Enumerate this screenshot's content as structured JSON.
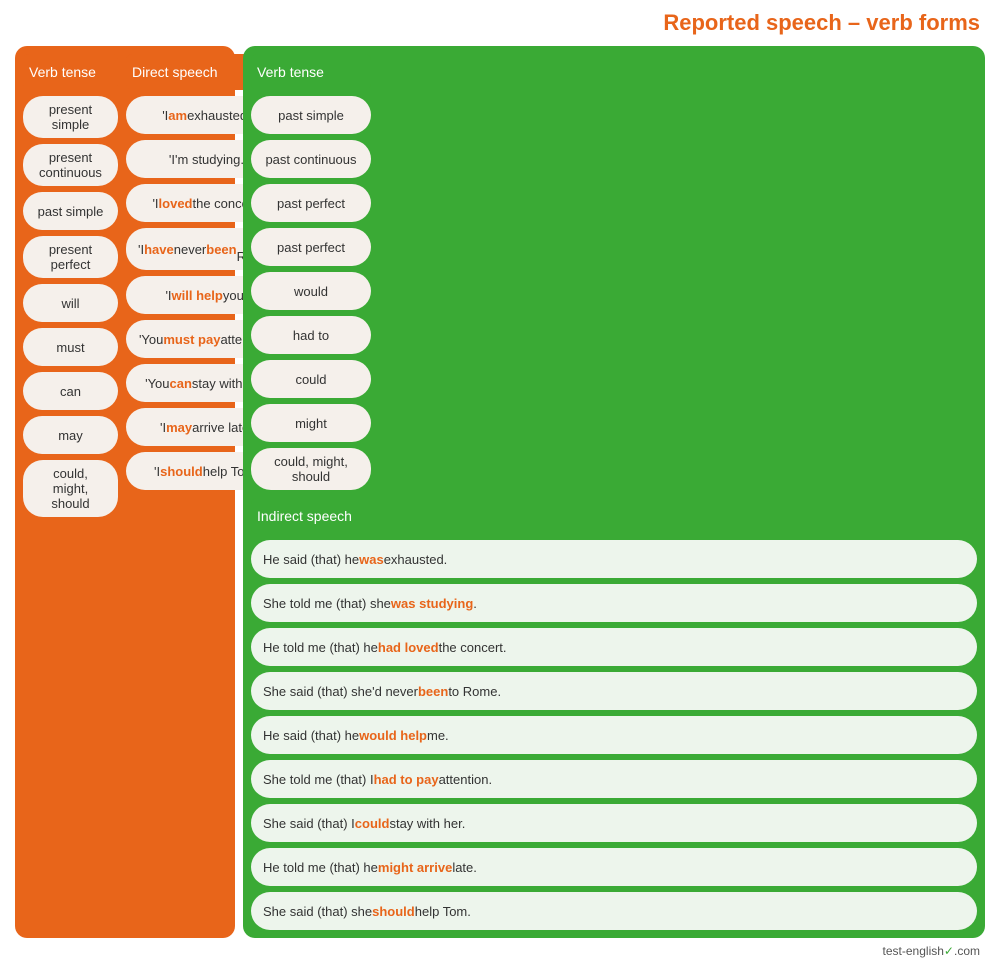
{
  "title": "Reported speech – verb forms",
  "left_panel": {
    "headers": [
      "Verb tense",
      "Direct speech"
    ],
    "rows": [
      {
        "verb": "present simple",
        "direct": [
          "'I ",
          "am",
          " exhausted.'"
        ]
      },
      {
        "verb": "present continuous",
        "direct": [
          "'I'm studying.'"
        ]
      },
      {
        "verb": "past simple",
        "direct": [
          "'I ",
          "loved",
          " the concert.'"
        ]
      },
      {
        "verb": "present perfect",
        "direct": [
          "'I ",
          "have",
          " never ",
          "been",
          " to Rome.'"
        ]
      },
      {
        "verb": "will",
        "direct": [
          "'I ",
          "will help",
          " you.'"
        ]
      },
      {
        "verb": "must",
        "direct": [
          "'You ",
          "must pay",
          " attention.'"
        ]
      },
      {
        "verb": "can",
        "direct": [
          "'You ",
          "can",
          " stay with me.'"
        ]
      },
      {
        "verb": "may",
        "direct": [
          "'I ",
          "may",
          " arrive late.'"
        ]
      },
      {
        "verb": "could, might, should",
        "direct": [
          "'I ",
          "should",
          " help Tom.'"
        ]
      }
    ]
  },
  "right_panel": {
    "headers": [
      "Verb tense",
      "Indirect speech"
    ],
    "rows": [
      {
        "verb": "past simple",
        "indirect": [
          "He said (that) he ",
          "was",
          " exhausted."
        ]
      },
      {
        "verb": "past continuous",
        "indirect": [
          "She told me (that) she ",
          "was studying",
          "."
        ]
      },
      {
        "verb": "past perfect",
        "indirect": [
          "He told me (that) he ",
          "had loved",
          " the concert."
        ]
      },
      {
        "verb": "past perfect",
        "indirect": [
          "She said (that) she'd never ",
          "been",
          " to Rome."
        ]
      },
      {
        "verb": "would",
        "indirect": [
          "He said (that) he ",
          "would help",
          " me."
        ]
      },
      {
        "verb": "had to",
        "indirect": [
          "She told me (that) I ",
          "had to pay",
          " attention."
        ]
      },
      {
        "verb": "could",
        "indirect": [
          "She said (that) I ",
          "could",
          " stay with her."
        ]
      },
      {
        "verb": "might",
        "indirect": [
          "He told me (that) he ",
          "might arrive",
          " late."
        ]
      },
      {
        "verb": "could, might, should",
        "indirect": [
          "She said (that) she ",
          "should",
          " help Tom."
        ]
      }
    ]
  },
  "footer": "test-english"
}
